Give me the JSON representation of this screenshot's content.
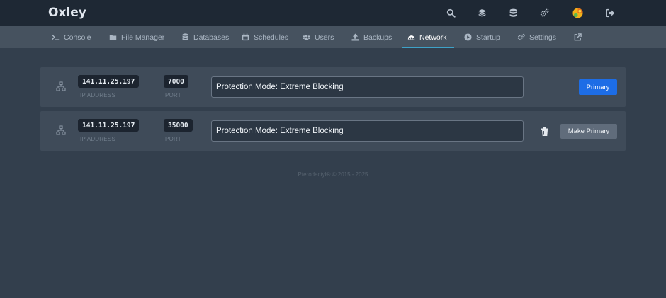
{
  "brand": "Oxley",
  "top_icons": [
    "search-icon",
    "layers-icon",
    "database-icon",
    "cogs-icon",
    "avatar",
    "logout-icon"
  ],
  "tabs": [
    {
      "label": "Console",
      "icon": "terminal-icon"
    },
    {
      "label": "File Manager",
      "icon": "folder-icon"
    },
    {
      "label": "Databases",
      "icon": "database-icon"
    },
    {
      "label": "Schedules",
      "icon": "calendar-icon"
    },
    {
      "label": "Users",
      "icon": "users-icon"
    },
    {
      "label": "Backups",
      "icon": "upload-icon"
    },
    {
      "label": "Network",
      "icon": "network-wired-icon",
      "active": true
    },
    {
      "label": "Startup",
      "icon": "play-icon"
    },
    {
      "label": "Settings",
      "icon": "cogs-icon"
    },
    {
      "label": "",
      "icon": "external-link-icon"
    }
  ],
  "allocations": [
    {
      "ip": "141.11.25.197",
      "ip_label": "IP ADDRESS",
      "port": "7000",
      "port_label": "PORT",
      "notes": "Protection Mode: Extreme Blocking",
      "button": "Primary",
      "is_primary": true
    },
    {
      "ip": "141.11.25.197",
      "ip_label": "IP ADDRESS",
      "port": "35000",
      "port_label": "PORT",
      "notes": "Protection Mode: Extreme Blocking",
      "button": "Make Primary",
      "is_primary": false
    }
  ],
  "footer": "Pterodactyl® © 2015 - 2025",
  "colors": {
    "accent": "#3ea2c8",
    "primary_button": "#1d6de6",
    "background": "#333f4d"
  }
}
